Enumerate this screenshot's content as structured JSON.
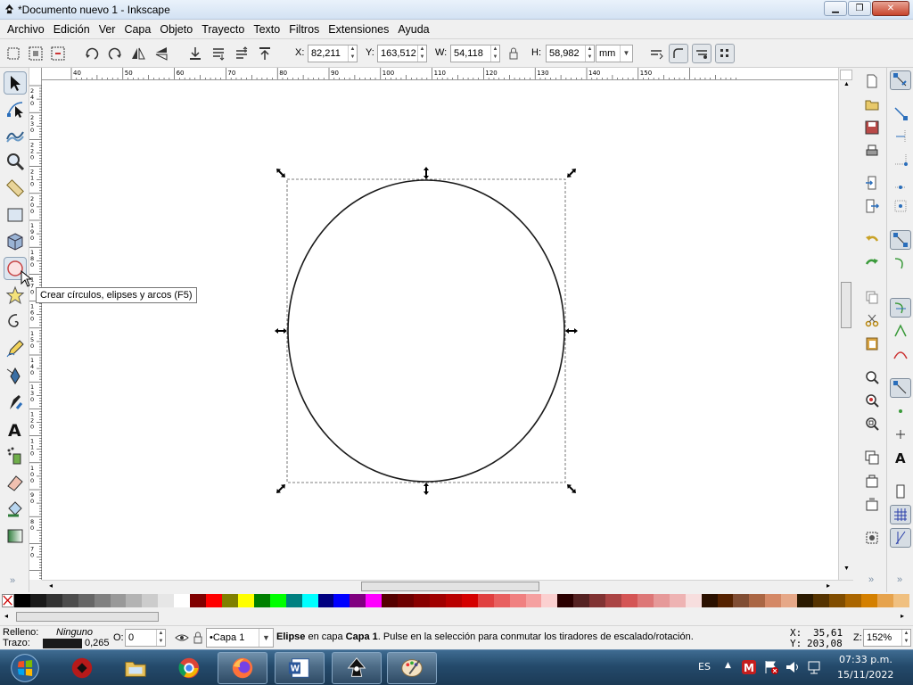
{
  "window": {
    "title": "*Documento nuevo 1 - Inkscape"
  },
  "menu": [
    "Archivo",
    "Edición",
    "Ver",
    "Capa",
    "Objeto",
    "Trayecto",
    "Texto",
    "Filtros",
    "Extensiones",
    "Ayuda"
  ],
  "controls": {
    "x_label": "X:",
    "x_value": "82,211",
    "y_label": "Y:",
    "y_value": "163,512",
    "w_label": "W:",
    "w_value": "54,118",
    "h_label": "H:",
    "h_value": "58,982",
    "unit": "mm"
  },
  "hruler_ticks": [
    "40",
    "50",
    "60",
    "70",
    "80",
    "90",
    "100",
    "110",
    "120",
    "130",
    "140",
    "150"
  ],
  "vruler_ticks": [
    "240",
    "230",
    "220",
    "210",
    "200",
    "190",
    "180",
    "170",
    "160",
    "150",
    "140",
    "130",
    "120",
    "110",
    "100",
    "90",
    "80",
    "70"
  ],
  "tooltip": "Crear círculos, elipses y arcos (F5)",
  "tools": [
    "selector-icon",
    "node-icon",
    "tweak-icon",
    "zoom-icon",
    "measure-icon",
    "rectangle-icon",
    "3d-box-icon",
    "ellipse-icon",
    "star-icon",
    "spiral-icon",
    "pencil-icon",
    "pen-icon",
    "calligraphy-icon",
    "text-icon",
    "spray-icon",
    "eraser-icon",
    "paint-bucket-icon",
    "gradient-icon"
  ],
  "palette": [
    "#000000",
    "#1a1a1a",
    "#333333",
    "#4d4d4d",
    "#666666",
    "#808080",
    "#999999",
    "#b3b3b3",
    "#cccccc",
    "#e6e6e6",
    "#ffffff",
    "#800000",
    "#ff0000",
    "#808000",
    "#ffff00",
    "#008000",
    "#00ff00",
    "#008080",
    "#00ffff",
    "#000080",
    "#0000ff",
    "#800080",
    "#ff00ff",
    "#550000",
    "#6d0000",
    "#880000",
    "#a00000",
    "#b80000",
    "#d40000",
    "#e04040",
    "#e86060",
    "#f08080",
    "#f5a0a0",
    "#fbd0d0",
    "#2b0000",
    "#552222",
    "#803333",
    "#aa4444",
    "#d45555",
    "#dd7777",
    "#e69999",
    "#eeb3b3",
    "#f7dede",
    "#2b1100",
    "#552200",
    "#804d33",
    "#aa6644",
    "#d48866",
    "#e6a888",
    "#2b1a00",
    "#553300",
    "#804d00",
    "#aa6600",
    "#d48000",
    "#e6a34d",
    "#f0c080"
  ],
  "status": {
    "fill_label": "Relleno:",
    "fill_value": "Ninguno",
    "stroke_label": "Trazo:",
    "stroke_width": "0,265",
    "opacity_label": "O:",
    "opacity_value": "0",
    "layer": "•Capa 1",
    "msg_obj": "Elipse",
    "msg_mid": " en capa ",
    "msg_layer": "Capa 1",
    "msg_end": ". Pulse en la selección para conmutar los tiradores de escalado/rotación.",
    "x_coord_label": "X:",
    "x_coord": "35,61",
    "y_coord_label": "Y:",
    "y_coord": "203,08",
    "zoom_label": "Z:",
    "zoom": "152%"
  },
  "taskbar": {
    "lang": "ES",
    "time": "07:33 p.m.",
    "date": "15/11/2022"
  },
  "colors": {
    "accent": "#ff6600",
    "selection": "#000000"
  }
}
